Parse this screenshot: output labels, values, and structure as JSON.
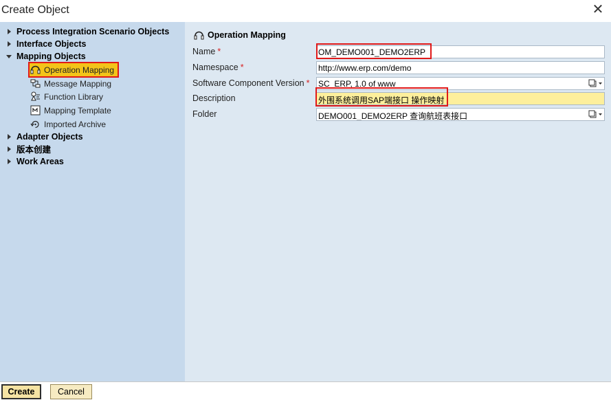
{
  "window": {
    "title": "Create Object",
    "close_glyph": "✕"
  },
  "tree": {
    "nodes": [
      {
        "label": "Process Integration Scenario Objects",
        "state": "collapsed"
      },
      {
        "label": "Interface Objects",
        "state": "collapsed"
      },
      {
        "label": "Mapping Objects",
        "state": "expanded"
      },
      {
        "label": "Adapter Objects",
        "state": "collapsed"
      },
      {
        "label": "版本创建",
        "state": "collapsed"
      },
      {
        "label": "Work Areas",
        "state": "collapsed"
      }
    ],
    "mapping_children": [
      {
        "label": "Operation Mapping",
        "icon": "operation-mapping-icon",
        "selected": true
      },
      {
        "label": "Message Mapping",
        "icon": "message-mapping-icon",
        "selected": false
      },
      {
        "label": "Function Library",
        "icon": "function-library-icon",
        "selected": false
      },
      {
        "label": "Mapping Template",
        "icon": "mapping-template-icon",
        "selected": false
      },
      {
        "label": "Imported Archive",
        "icon": "imported-archive-icon",
        "selected": false
      }
    ]
  },
  "form": {
    "section_title": "Operation Mapping",
    "fields": [
      {
        "label": "Name",
        "required": "*",
        "value": "OM_DEMO001_DEMO2ERP"
      },
      {
        "label": "Namespace",
        "required": "*",
        "value": "http://www.erp.com/demo"
      },
      {
        "label": "Software Component Version",
        "required": "*",
        "value": "SC_ERP, 1.0 of www"
      },
      {
        "label": "Description",
        "required": "",
        "value": "外围系统调用SAP端接口 操作映射"
      },
      {
        "label": "Folder",
        "required": "",
        "value": "DEMO001_DEMO2ERP 查询航班表接口"
      }
    ]
  },
  "buttons": {
    "create": "Create",
    "cancel": "Cancel"
  },
  "colors": {
    "left_pane": "#c6d9ec",
    "right_pane": "#dde8f2",
    "selected_bg": "#f3c419",
    "highlight_border": "#e01818",
    "description_bg": "#fdef9c"
  }
}
